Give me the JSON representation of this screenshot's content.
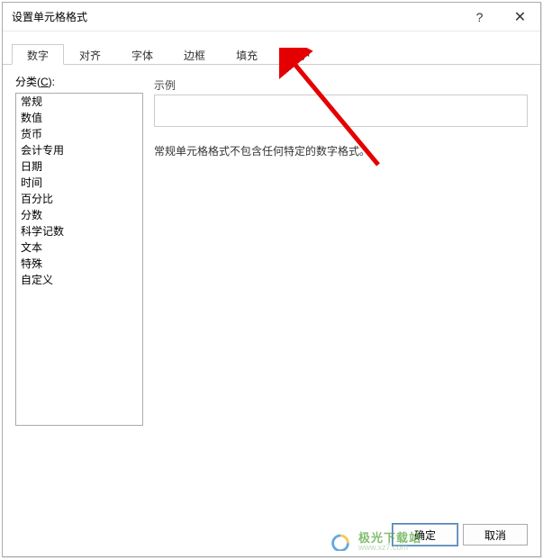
{
  "titlebar": {
    "title": "设置单元格格式",
    "help_icon": "?",
    "close_icon": "✕"
  },
  "tabs": {
    "items": [
      {
        "label": "数字"
      },
      {
        "label": "对齐"
      },
      {
        "label": "字体"
      },
      {
        "label": "边框"
      },
      {
        "label": "填充"
      },
      {
        "label": "保护"
      }
    ]
  },
  "category": {
    "label_prefix": "分类(",
    "label_key": "C",
    "label_suffix": "):",
    "items": [
      "常规",
      "数值",
      "货币",
      "会计专用",
      "日期",
      "时间",
      "百分比",
      "分数",
      "科学记数",
      "文本",
      "特殊",
      "自定义"
    ]
  },
  "sample": {
    "label": "示例"
  },
  "description": "常规单元格格式不包含任何特定的数字格式。",
  "footer": {
    "ok": "确定",
    "cancel": "取消"
  },
  "watermark": {
    "cn": "极光下载站",
    "en": "www.xz7.com"
  }
}
